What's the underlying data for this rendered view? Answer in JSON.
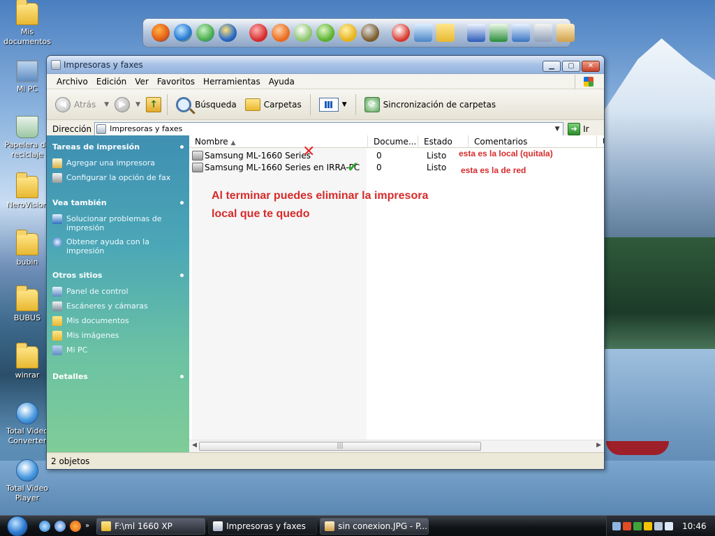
{
  "desktop": {
    "icons": [
      {
        "label": "Mis\ndocumentos",
        "icon": "folder-documents-icon"
      },
      {
        "label": "Mi PC",
        "icon": "computer-icon"
      },
      {
        "label": "Papelera de\nreciclaje",
        "icon": "recycle-bin-icon"
      },
      {
        "label": "NeroVision",
        "icon": "folder-icon"
      },
      {
        "label": "bubin",
        "icon": "folder-icon"
      },
      {
        "label": "BUBUS",
        "icon": "folder-icon"
      },
      {
        "label": "winrar",
        "icon": "folder-icon"
      },
      {
        "label": "Total Video\nConverter",
        "icon": "video-converter-icon"
      },
      {
        "label": "Total Video\nPlayer",
        "icon": "video-player-icon"
      }
    ]
  },
  "dock": {
    "icons": [
      "firefox-icon",
      "ie-icon",
      "messenger-icon",
      "media-player-icon",
      "poker-icon",
      "p-icon",
      "flower-app-icon",
      "utorrent-icon",
      "duck-icon",
      "game-icon",
      "app-icon",
      "network-icon",
      "folder-icon",
      "word-icon",
      "excel-icon",
      "notepad-icon",
      "calculator-icon",
      "paint-icon"
    ]
  },
  "window": {
    "title": "Impresoras y faxes",
    "menu": [
      "Archivo",
      "Edición",
      "Ver",
      "Favoritos",
      "Herramientas",
      "Ayuda"
    ],
    "toolbar": {
      "back": "Atrás",
      "search": "Búsqueda",
      "folders": "Carpetas",
      "sync": "Sincronización de carpetas"
    },
    "address": {
      "label": "Dirección",
      "value": "Impresoras y faxes",
      "go": "Ir"
    },
    "sidebar": {
      "sections": [
        {
          "title": "Tareas de impresión",
          "links": [
            "Agregar una impresora",
            "Configurar la opción de fax"
          ]
        },
        {
          "title": "Vea también",
          "links": [
            "Solucionar problemas de impresión",
            "Obtener ayuda con la impresión"
          ]
        },
        {
          "title": "Otros sitios",
          "links": [
            "Panel de control",
            "Escáneres y cámaras",
            "Mis documentos",
            "Mis imágenes",
            "Mi PC"
          ]
        },
        {
          "title": "Detalles",
          "links": []
        }
      ]
    },
    "columns": [
      "Nombre",
      "Docume...",
      "Estado",
      "Comentarios"
    ],
    "rows": [
      {
        "name": "Samsung ML-1660 Series",
        "docs": "0",
        "status": "Listo"
      },
      {
        "name": "Samsung ML-1660 Series en IRRA-PC",
        "docs": "0",
        "status": "Listo"
      }
    ],
    "annotations": {
      "local": "esta es la local (quitala)",
      "red": "esta es la de red",
      "main_line1": "Al terminar puedes eliminar la impresora",
      "main_line2": "local que te quedo"
    },
    "status": "2 objetos"
  },
  "taskbar": {
    "tasks": [
      "F:\\ml 1660 XP",
      "Impresoras y faxes",
      "sin conexion.JPG - P..."
    ],
    "clock": "10:46"
  },
  "colors": {
    "annotation": "#d62b2b",
    "sidebar": "#4ba7b6"
  }
}
